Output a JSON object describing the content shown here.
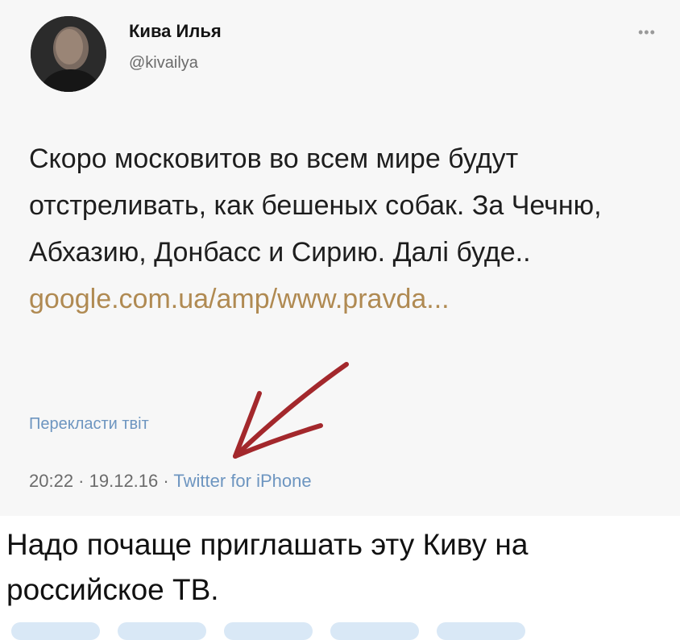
{
  "tweet": {
    "author_name": "Кива Илья",
    "author_handle": "@kivailya",
    "more_icon": "more-dots-icon",
    "text_main": "Скоро московитов во всем мире будут отстреливать, как бешеных собак. За Чечню, Абхазию, Донбасс и Сирию. Далi буде.. ",
    "link_text": "google.com.ua/amp/www.pravda...",
    "translate_label": "Перекласти твiт",
    "time": "20:22",
    "date": "19.12.16",
    "separator": " · ",
    "source": "Twitter for iPhone"
  },
  "caption": "Надо почаще приглашать эту Киву на российское ТВ.",
  "colors": {
    "link": "#b08a52",
    "accent_blue": "#6d95c0",
    "arrow_red": "#a3282c",
    "card_bg": "#f7f7f7"
  }
}
